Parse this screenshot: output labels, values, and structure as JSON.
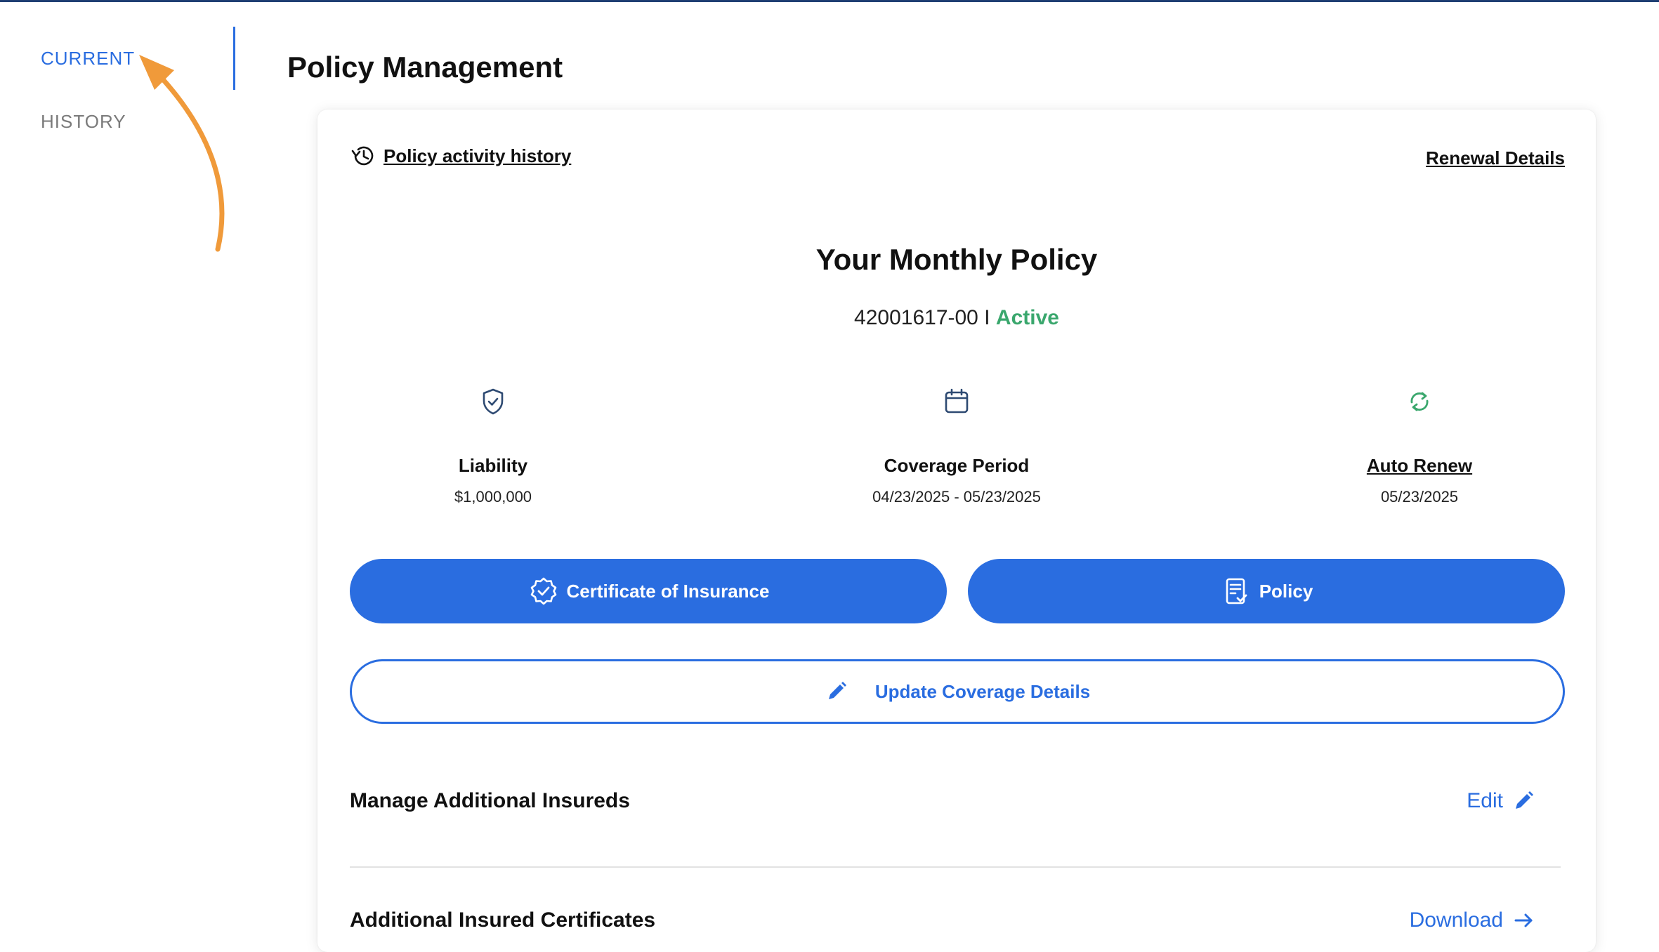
{
  "nav": {
    "items": [
      {
        "label": "CURRENT",
        "active": true
      },
      {
        "label": "HISTORY",
        "active": false
      }
    ]
  },
  "page": {
    "title": "Policy Management"
  },
  "card": {
    "activity_link": "Policy activity history",
    "renewal_link": "Renewal Details",
    "policy_title": "Your Monthly Policy",
    "policy_number": "42001617-00",
    "separator": "I",
    "status": "Active",
    "stats": {
      "liability": {
        "label": "Liability",
        "value": "$1,000,000",
        "icon": "shield-check-icon"
      },
      "coverage": {
        "label": "Coverage Period",
        "value": "04/23/2025 - 05/23/2025",
        "icon": "calendar-icon"
      },
      "renew": {
        "label": "Auto Renew",
        "value": "05/23/2025",
        "icon": "refresh-icon"
      }
    },
    "buttons": {
      "coi": "Certificate of Insurance",
      "policy": "Policy",
      "update": "Update Coverage Details"
    },
    "sections": {
      "insureds": {
        "title": "Manage Additional Insureds",
        "action": "Edit"
      },
      "certs": {
        "title": "Additional Insured Certificates",
        "action": "Download"
      }
    }
  },
  "colors": {
    "accent": "#2a6de0",
    "active_status": "#3aa76d",
    "annotation_arrow": "#f09a3a"
  }
}
